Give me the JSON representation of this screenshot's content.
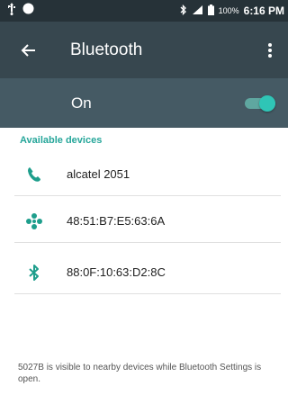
{
  "status_bar": {
    "battery_percent": "100%",
    "time": "6:16 PM",
    "icons": [
      "usb-icon",
      "notification-dot-icon",
      "bluetooth-icon",
      "signal-icon",
      "battery-icon"
    ]
  },
  "toolbar": {
    "title": "Bluetooth",
    "back_icon": "arrow-left-icon",
    "menu_icon": "more-vert-icon"
  },
  "master_switch": {
    "label": "On",
    "state": true,
    "accent_color": "#2fc5b6"
  },
  "available_devices": {
    "header": "Available devices",
    "header_color": "#26a69a",
    "items": [
      {
        "name": "alcatel 2051",
        "icon": "phone-icon"
      },
      {
        "name": "48:51:B7:E5:63:6A",
        "icon": "dots-cluster-icon"
      },
      {
        "name": "88:0F:10:63:D2:8C",
        "icon": "bluetooth-icon"
      }
    ]
  },
  "footer": {
    "text": "5027B is visible to nearby devices while Bluetooth Settings is open."
  },
  "colors": {
    "status_bar": "#263238",
    "toolbar": "#37474f",
    "switch_bar": "#455a64",
    "icon_teal": "#1e9e8c"
  }
}
